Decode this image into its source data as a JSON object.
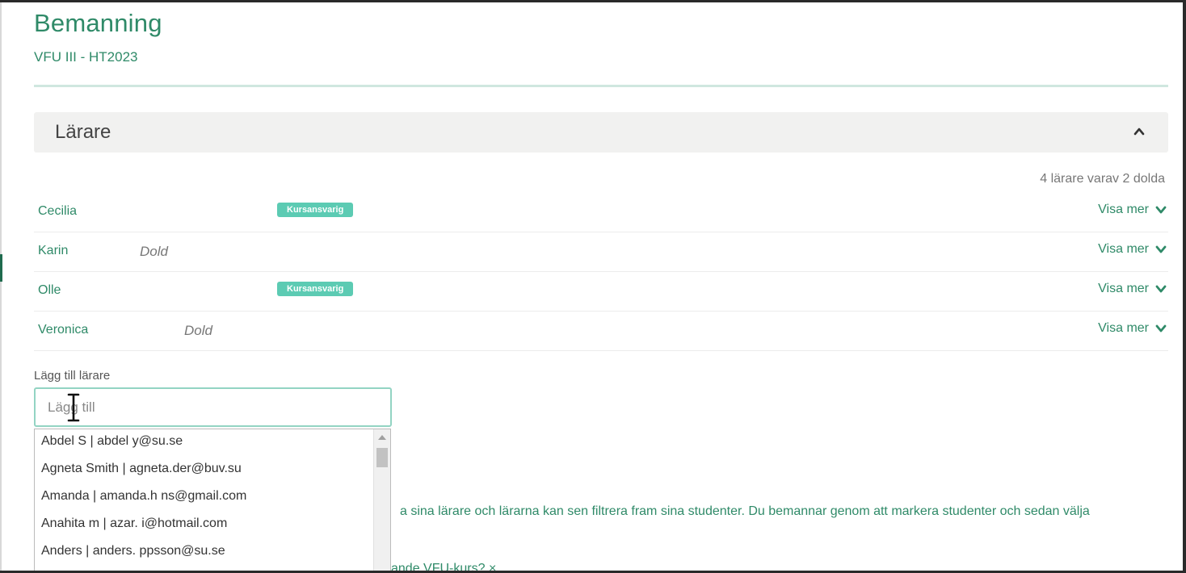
{
  "header": {
    "title": "Bemanning",
    "subtitle": "VFU III - HT2023"
  },
  "panel": {
    "title": "Lärare",
    "count_text": "4 lärare varav 2 dolda"
  },
  "teachers": [
    {
      "name": "Cecilia",
      "badge": "Kursansvarig",
      "hidden_label": "",
      "action": "Visa mer"
    },
    {
      "name": "Karin",
      "badge": "",
      "hidden_label": "Dold",
      "action": "Visa mer"
    },
    {
      "name": "Olle",
      "badge": "Kursansvarig",
      "hidden_label": "",
      "action": "Visa mer"
    },
    {
      "name": "Veronica",
      "badge": "",
      "hidden_label": "Dold",
      "action": "Visa mer"
    }
  ],
  "add_teacher": {
    "label": "Lägg till lärare",
    "placeholder": "Lägg till"
  },
  "suggestions": [
    "Abdel S | abdel y@su.se",
    "Agneta Smith | agneta.der@buv.su",
    "Amanda | amanda.h ns@gmail.com",
    "Anahita m | azar. i@hotmail.com",
    "Anders | anders. ppsson@su.se"
  ],
  "info_text": "a sina lärare och lärarna kan sen filtrera fram sina studenter. Du bemannar genom att markera studenter och sedan välja",
  "bottom_link": "ande VFU-kurs? ×",
  "colors": {
    "accent": "#2f8a68",
    "badge": "#5ccbb3",
    "panel_bg": "#f1f1f0"
  }
}
